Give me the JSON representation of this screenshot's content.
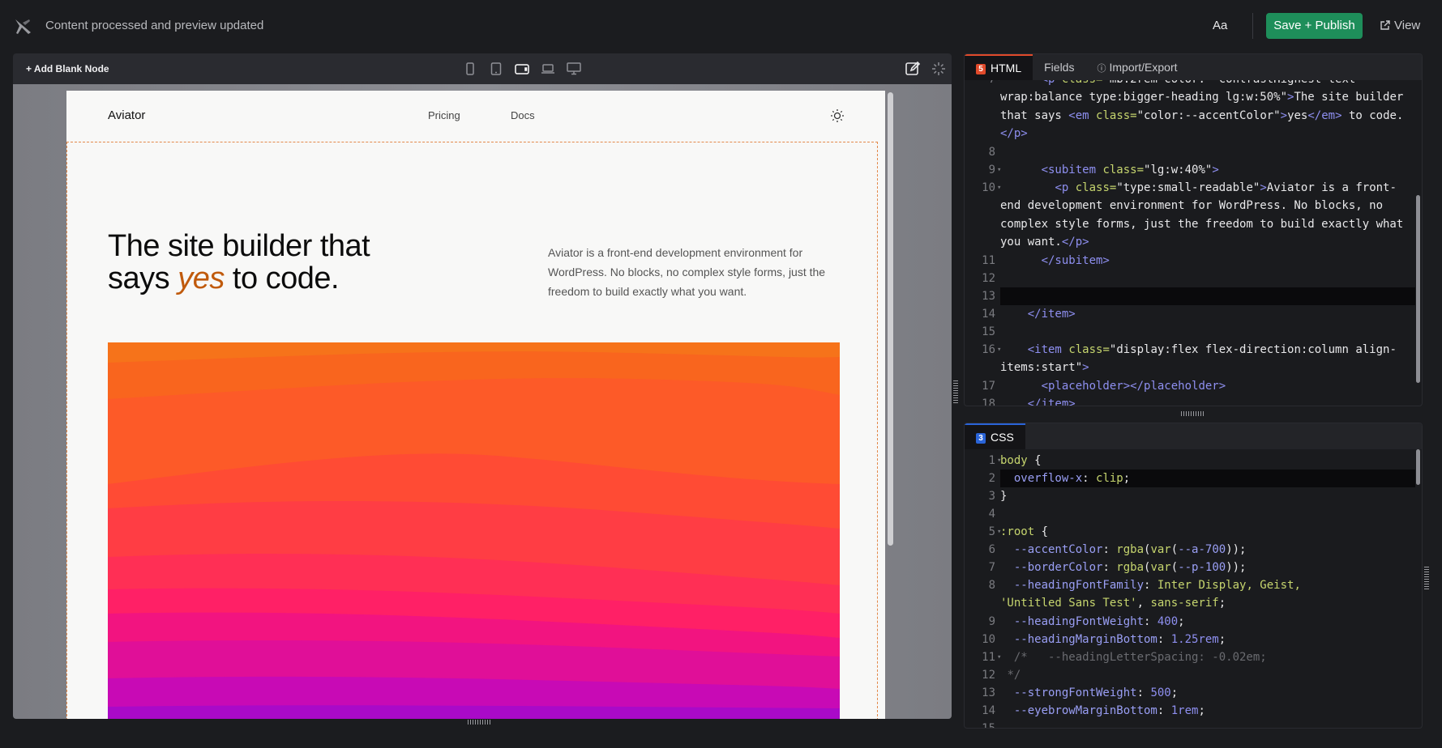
{
  "topbar": {
    "status": "Content processed and preview updated",
    "font_button": "Aa",
    "publish_label": "Save + Publish",
    "view_label": "View"
  },
  "canvas_toolbar": {
    "add_node_label": "+ Add Blank Node",
    "devices": [
      "mobile-icon",
      "tablet-icon",
      "tablet-landscape-icon",
      "laptop-icon",
      "desktop-icon"
    ],
    "active_device": "tablet-landscape-icon"
  },
  "preview": {
    "brand": "Aviator",
    "nav": [
      "Pricing",
      "Docs"
    ],
    "heading_line1": "The site builder that",
    "heading_pre": "says ",
    "heading_em": "yes",
    "heading_post": " to code.",
    "description": "Aviator is a front-end development environment for WordPress. No blocks, no complex style forms, just the freedom to build exactly what you want."
  },
  "html_panel": {
    "tabs": [
      {
        "label": "HTML",
        "active": true
      },
      {
        "label": "Fields",
        "active": false
      },
      {
        "label": "Import/Export",
        "active": false
      }
    ]
  },
  "css_panel": {
    "tab": "CSS"
  },
  "colors": {
    "accent": "#1e8e5a",
    "em": "#c05a0c",
    "tab_active_border": "#e14a2b"
  }
}
